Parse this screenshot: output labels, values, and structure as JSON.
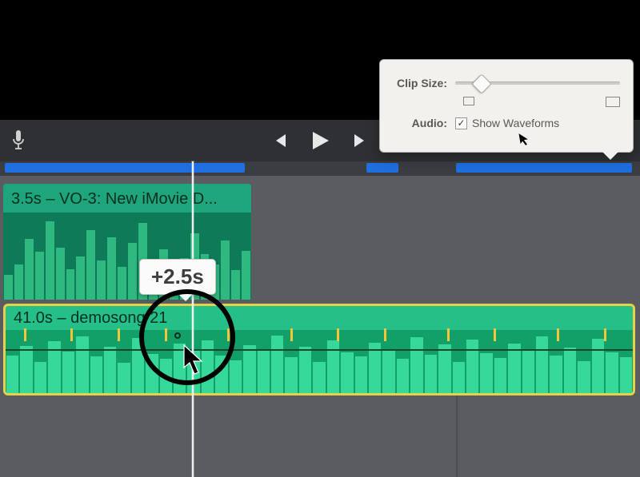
{
  "popover": {
    "clip_size_label": "Clip Size:",
    "audio_label": "Audio:",
    "show_waveforms_label": "Show Waveforms",
    "show_waveforms_checked": true
  },
  "clips": {
    "voiceover": {
      "duration": "3.5s",
      "name": "VO-3: New iMovie D...",
      "label": "3.5s – VO-3: New iMovie D..."
    },
    "music": {
      "duration": "41.0s",
      "name": "demosong 21",
      "label": "41.0s – demosong 21"
    }
  },
  "tooltip": {
    "offset": "+2.5s"
  },
  "icons": {
    "mic": "microphone-icon",
    "prev": "skip-back-icon",
    "play": "play-icon",
    "next": "skip-forward-icon"
  }
}
